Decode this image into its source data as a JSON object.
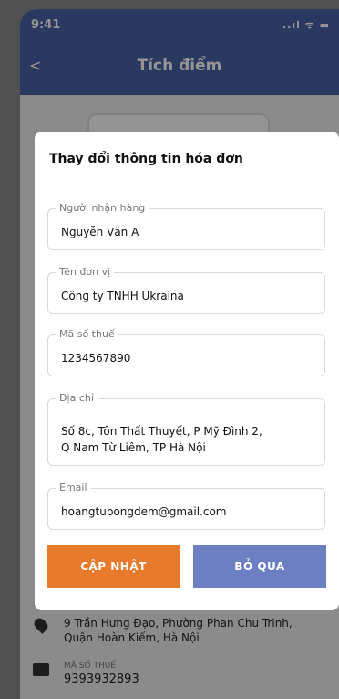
{
  "status_bar": {
    "time": "9:41",
    "icons": "..ıl ᯤ ▬",
    "icons_semantic": [
      "signal-icon",
      "wifi-icon",
      "battery-icon"
    ]
  },
  "app_bar": {
    "back_icon": "<",
    "title": "Tích điểm"
  },
  "background": {
    "address": "9 Trần Hưng Đạo, Phường Phan Chu Trinh,\nQuận Hoàn Kiếm, Hà Nội",
    "tax_label": "MÃ SỐ THUẾ",
    "tax_value": "9393932893",
    "colors": {
      "brand": "#4a62a7"
    }
  },
  "dialog": {
    "title": "Thay đổi thông tin hóa đơn",
    "fields": [
      {
        "label": "Người nhận hàng",
        "value": "Nguyễn Văn A"
      },
      {
        "label": "Tên đơn vị",
        "value": "Công ty TNHH Ukraina"
      },
      {
        "label": "Mã số thuế",
        "value": "1234567890"
      },
      {
        "label": "Địa chỉ",
        "value": "Số 8c, Tôn Thất Thuyết, P Mỹ Đình 2,\nQ Nam Từ Liêm, TP Hà Nội"
      },
      {
        "label": "Email",
        "value": "hoangtubongdem@gmail.com"
      }
    ],
    "update_button": "CẬP NHẬT",
    "skip_button": "BỎ QUA",
    "colors": {
      "update": "#e87a2b",
      "skip": "#6b7fc2"
    }
  }
}
